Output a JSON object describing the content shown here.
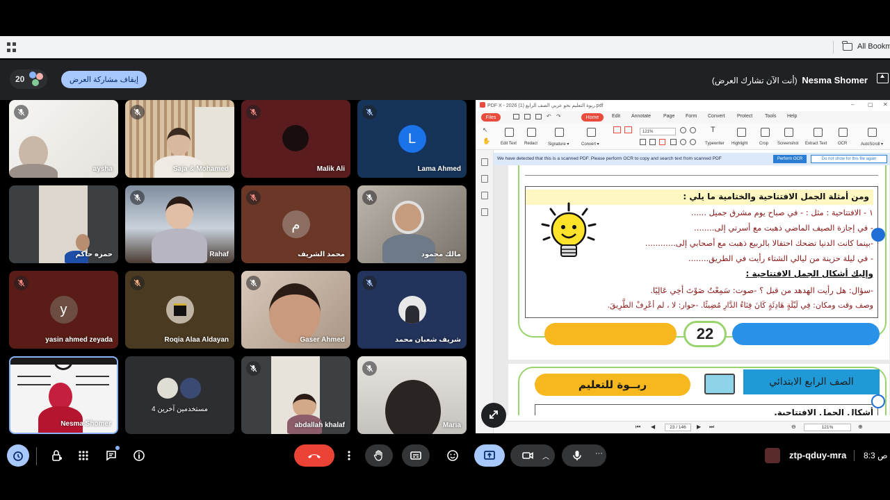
{
  "browser": {
    "bookmarks_label": "All Bookma"
  },
  "meet": {
    "participant_count": "20",
    "stop_presenting_label": "إيقاف مشاركة العرض",
    "presenter_name": "Nesma Shomer",
    "presenting_status": "(أنت الآن تشارك العرض)",
    "meeting_code": "ztp-qduy-mra",
    "time": "8:3",
    "time_suffix": "ص",
    "colors": {
      "accent": "#a8c7fa",
      "end_call": "#ea4335",
      "active_ctrl": "#a8c7fa"
    }
  },
  "tiles": [
    {
      "name": "aysha"
    },
    {
      "name": "Saja & Mohamed"
    },
    {
      "name": "Malik Ali"
    },
    {
      "name": "Lama Ahmed",
      "initial": "L"
    },
    {
      "name": "حمزه حاكم"
    },
    {
      "name": "Rahaf"
    },
    {
      "name": "محمد الشريف",
      "initial": "م"
    },
    {
      "name": "مالك محمود"
    },
    {
      "name": "yasin ahmed zeyada",
      "initial": "y"
    },
    {
      "name": "Roqia Alaa Aldayan"
    },
    {
      "name": "Gaser Ahmed"
    },
    {
      "name": "شريف شعبان محمد"
    },
    {
      "name": "Nesma Shomer"
    },
    {
      "name": "4 مستخدمين آخرين"
    },
    {
      "name": "abdallah khalaf"
    },
    {
      "name": "Maria"
    }
  ],
  "pdf": {
    "window_title": "PDF X - 2026 ربوة التعليم نحو عربي الصف الرابع (1).pdf",
    "files_label": "Files",
    "menu": [
      "Home",
      "Edit",
      "Annotate",
      "Page",
      "Form",
      "Convert",
      "Protect",
      "Tools",
      "Help"
    ],
    "tools": [
      "Edit Text",
      "Redact",
      "Signature ▾",
      "Convert ▾",
      "Typewriter",
      "Highlight",
      "Crop",
      "Screenshot",
      "Extract Text",
      "OCR",
      "AutoScroll ▾"
    ],
    "zoom": "121%",
    "ocr_message": "We have detected that this is a scanned PDF.  Please perform OCR to copy and search text from scanned PDF",
    "ocr_button": "Perform OCR",
    "ocr_dismiss": "Do not show for this file again",
    "page_indicator": "23 / 146",
    "status_zoom": "121%",
    "page": {
      "heading": "ومن أمثلة الجمل الافتتاحية والختامية ما يلي :",
      "line1": "١ - الافتتاحية : مثل : - في صباح يوم مشرق جميل ......",
      "line2": "- في إجازة الصيف الماضي ذهبت مع أسرتي إلى........",
      "line3": "-بينما كانت الدنيا تضحك احتفالا بالربيع ذهبت مع أصحابي إلى............",
      "line4": "- في ليلة حزينة من ليالي الشتاء رأيت في الطريق........",
      "line5": "وإليك أشكال الجمل الافتتاحية :",
      "line6": "-سؤال: هل رأيت الهدهد من قبل ؟    -صوت: سَمِعْتُ صَوْتَ أخِي عَالِيًا.",
      "line7": "وصف وقت ومكان: فِي لَيْلَةٍ هَادِئَةٍ كَانَ فِنَاءُ الدَّارِ مُضِيئًا. -حوار: لا ، لم أعْرِفْ الطَّرِيقَ.",
      "page_number": "22",
      "next_brand": "ربــوة للتعليم",
      "next_grade": "الصف الرابع الابتدائي",
      "next_heading": "أشكال الجمل الافتتاحية."
    }
  }
}
